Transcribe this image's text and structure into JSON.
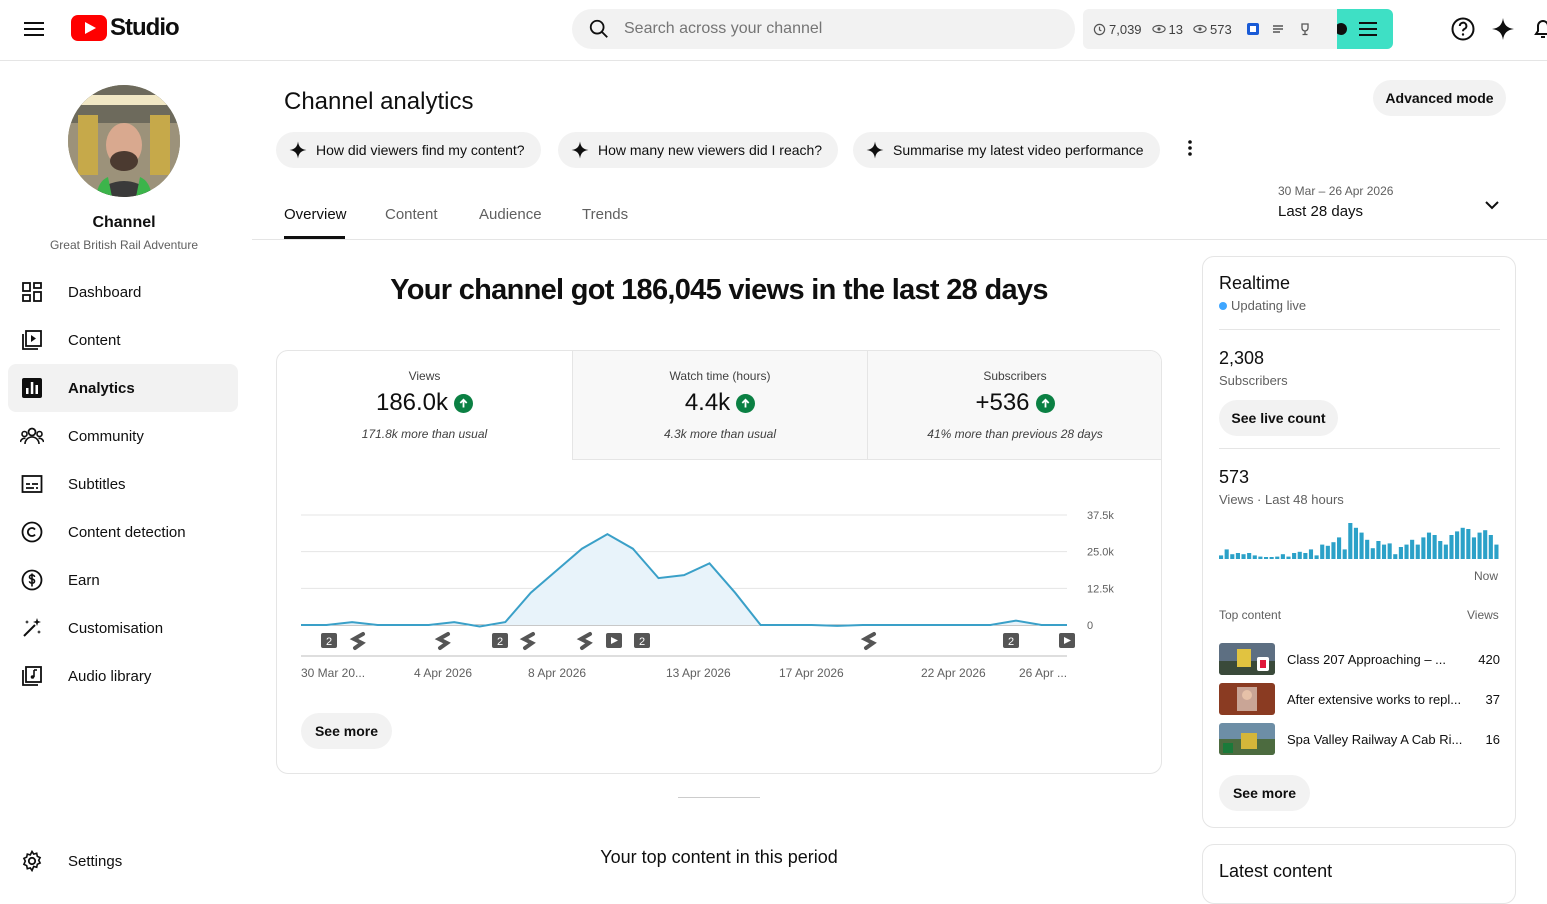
{
  "topbar": {
    "logo_text": "Studio",
    "search_placeholder": "Search across your channel",
    "stats": {
      "watch": "7,039",
      "views_a": "13",
      "views_b": "573"
    }
  },
  "sidebar": {
    "channel_name": "Channel",
    "channel_handle": "Great British Rail Adventure",
    "items": [
      {
        "label": "Dashboard",
        "icon": "dashboard-icon"
      },
      {
        "label": "Content",
        "icon": "content-icon"
      },
      {
        "label": "Analytics",
        "icon": "analytics-icon"
      },
      {
        "label": "Community",
        "icon": "community-icon"
      },
      {
        "label": "Subtitles",
        "icon": "subtitles-icon"
      },
      {
        "label": "Content detection",
        "icon": "copyright-icon"
      },
      {
        "label": "Earn",
        "icon": "earn-icon"
      },
      {
        "label": "Customisation",
        "icon": "magic-wand-icon"
      },
      {
        "label": "Audio library",
        "icon": "audio-library-icon"
      }
    ],
    "settings_label": "Settings"
  },
  "main": {
    "title": "Channel analytics",
    "advanced_mode": "Advanced mode",
    "chips": [
      "How did viewers find my content?",
      "How many new viewers did I reach?",
      "Summarise my latest video performance"
    ],
    "tabs": [
      "Overview",
      "Content",
      "Audience",
      "Trends"
    ],
    "date_range": {
      "range": "30 Mar – 26 Apr 2026",
      "label": "Last 28 days"
    },
    "headline": "Your channel got 186,045 views in the last 28 days",
    "metrics": [
      {
        "label": "Views",
        "value": "186.0k",
        "note": "171.8k more than usual"
      },
      {
        "label": "Watch time (hours)",
        "value": "4.4k",
        "note": "4.3k more than usual"
      },
      {
        "label": "Subscribers",
        "value": "+536",
        "note": "41% more than previous 28 days"
      }
    ],
    "see_more": "See more",
    "top_content_title": "Your top content in this period"
  },
  "chart_data": {
    "type": "area",
    "series": [
      {
        "values": [
          0,
          0,
          1000,
          0,
          0,
          0,
          1000,
          -500,
          1000,
          11000,
          18500,
          26000,
          31000,
          26000,
          16000,
          17000,
          21000,
          11000,
          0,
          0,
          0,
          -300,
          0,
          0,
          0,
          0,
          0,
          0,
          1500,
          0,
          0
        ]
      }
    ],
    "ylim": [
      0,
      37500
    ],
    "y_ticks": [
      "37.5k",
      "25.0k",
      "12.5k",
      "0"
    ],
    "x_tick_labels": [
      "30 Mar 20...",
      "4 Apr 2026",
      "8 Apr 2026",
      "13 Apr 2026",
      "17 Apr 2026",
      "22 Apr 2026",
      "26 Apr ..."
    ],
    "markers": [
      {
        "kind": "count",
        "text": "2"
      },
      {
        "kind": "short"
      },
      {
        "kind": "short"
      },
      {
        "kind": "count",
        "text": "2"
      },
      {
        "kind": "short"
      },
      {
        "kind": "short"
      },
      {
        "kind": "video"
      },
      {
        "kind": "count",
        "text": "2"
      },
      {
        "kind": "short"
      },
      {
        "kind": "count",
        "text": "2"
      },
      {
        "kind": "video"
      }
    ],
    "grid": true
  },
  "realtime": {
    "title": "Realtime",
    "status": "Updating live",
    "subs_value": "2,308",
    "subs_label": "Subscribers",
    "see_live_count": "See live count",
    "views_value": "573",
    "views_label": "Views · Last 48 hours",
    "now_label": "Now",
    "bars": [
      3,
      8,
      4,
      5,
      4,
      5,
      3,
      2,
      1,
      1,
      2,
      4,
      2,
      5,
      6,
      5,
      8,
      3,
      12,
      11,
      14,
      18,
      8,
      30,
      26,
      22,
      16,
      9,
      15,
      12,
      13,
      4,
      10,
      12,
      16,
      12,
      18,
      22,
      20,
      15,
      12,
      20,
      23,
      26,
      25,
      18,
      22,
      24,
      20,
      12
    ],
    "top_content_label": "Top content",
    "views_col_label": "Views",
    "top_content": [
      {
        "title": "Class 207 Approaching – ...",
        "views": "420"
      },
      {
        "title": "After extensive works to repl...",
        "views": "37"
      },
      {
        "title": "Spa Valley Railway A Cab Ri...",
        "views": "16"
      }
    ],
    "see_more": "See more"
  },
  "latest": {
    "title": "Latest content"
  }
}
